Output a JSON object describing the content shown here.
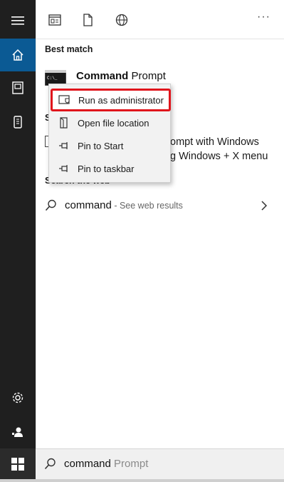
{
  "rail": {
    "items": [
      "hamburger-icon",
      "home-icon",
      "documents-icon",
      "device-icon",
      "settings-icon",
      "feedback-icon"
    ]
  },
  "topbar": {
    "more": "···"
  },
  "best_match": {
    "label": "Best match",
    "app_name_bold": "Command",
    "app_name_rest": " Prompt"
  },
  "hidden_row": {
    "line1": "ompt with Windows",
    "line2": "g Windows + X menu",
    "section_fragment": "S"
  },
  "context_menu": {
    "items": [
      {
        "label": "Run as administrator",
        "icon": "shield-icon"
      },
      {
        "label": "Open file location",
        "icon": "folder-icon"
      },
      {
        "label": "Pin to Start",
        "icon": "pin-icon"
      },
      {
        "label": "Pin to taskbar",
        "icon": "pin-icon"
      }
    ]
  },
  "web": {
    "label": "Search the web",
    "query": "command",
    "suffix": " - See web results"
  },
  "search": {
    "typed": "command",
    "suggestion": " Prompt"
  },
  "colors": {
    "accent": "#0b5a94",
    "highlight": "#e0151c",
    "rail": "#1f1f1f"
  }
}
